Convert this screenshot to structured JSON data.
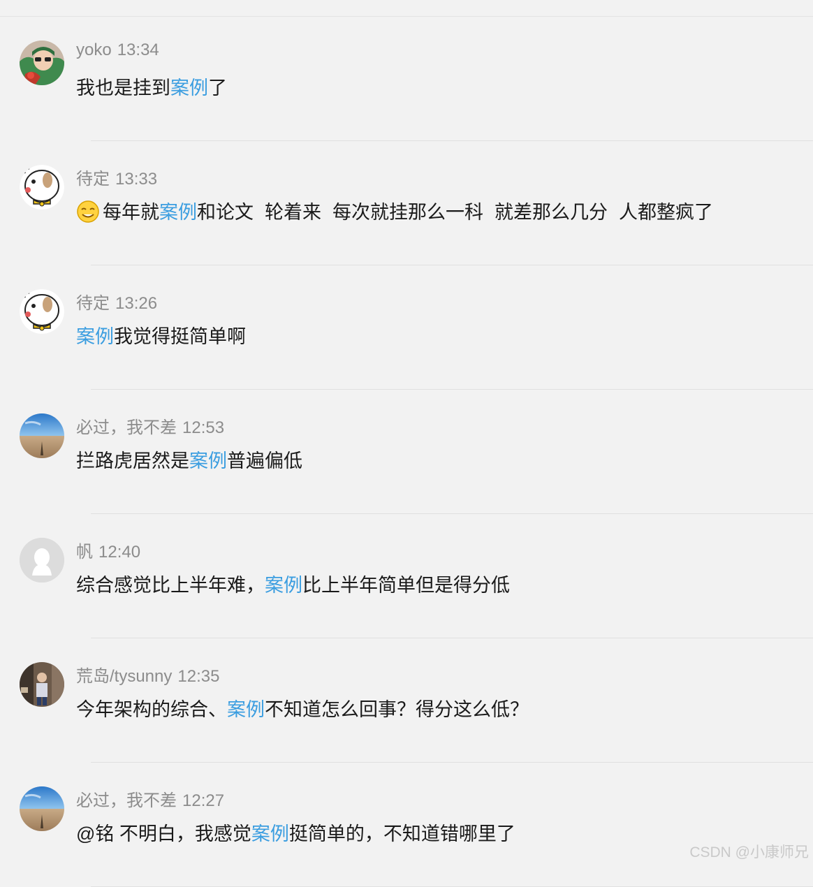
{
  "messages": [
    {
      "user": "yoko",
      "time": "13:34",
      "segments": [
        {
          "t": "我也是挂到"
        },
        {
          "t": "案例",
          "k": true
        },
        {
          "t": "了"
        }
      ],
      "avatar": "avatar-child-photo"
    },
    {
      "user": "待定",
      "time": "13:33",
      "segments": [
        {
          "t": "每年就"
        },
        {
          "t": "案例",
          "k": true
        },
        {
          "t": "和论文"
        },
        {
          "sp": 1
        },
        {
          "t": "轮着来"
        },
        {
          "sp": 1
        },
        {
          "t": "每次就挂那么一科"
        },
        {
          "sp": 1
        },
        {
          "t": "就差那么几分"
        },
        {
          "sp": 1
        },
        {
          "t": "人都整疯了"
        }
      ],
      "emoji": "smirk-emoji",
      "avatar": "avatar-cartoon-cow"
    },
    {
      "user": "待定",
      "time": "13:26",
      "segments": [
        {
          "t": "案例",
          "k": true
        },
        {
          "t": "我觉得挺简单啊"
        }
      ],
      "avatar": "avatar-cartoon-cow"
    },
    {
      "user": "必过，我不差",
      "time": "12:53",
      "segments": [
        {
          "t": "拦路虎居然是"
        },
        {
          "t": "案例",
          "k": true
        },
        {
          "t": "普遍偏低"
        }
      ],
      "avatar": "avatar-beach-sky"
    },
    {
      "user": "帆",
      "time": "12:40",
      "segments": [
        {
          "t": "综合感觉比上半年难，"
        },
        {
          "t": "案例",
          "k": true
        },
        {
          "t": "比上半年简单但是得分低"
        }
      ],
      "avatar": "avatar-default-penguin"
    },
    {
      "user": "荒岛/tysunny",
      "time": "12:35",
      "segments": [
        {
          "t": "今年架构的综合、"
        },
        {
          "t": "案例",
          "k": true
        },
        {
          "t": "不知道怎么回事？得分这么低？"
        }
      ],
      "avatar": "avatar-street-photo"
    },
    {
      "user": "必过，我不差",
      "time": "12:27",
      "segments": [
        {
          "t": "@铭 不明白，我感觉"
        },
        {
          "t": "案例",
          "k": true
        },
        {
          "t": "挺简单的，不知道错哪里了"
        }
      ],
      "avatar": "avatar-beach-sky"
    }
  ],
  "watermark": "CSDN @小康师兄",
  "colors": {
    "keyword": "#3a9de0",
    "meta": "#8c8c8c",
    "text": "#1a1a1a",
    "background": "#f2f2f2"
  }
}
